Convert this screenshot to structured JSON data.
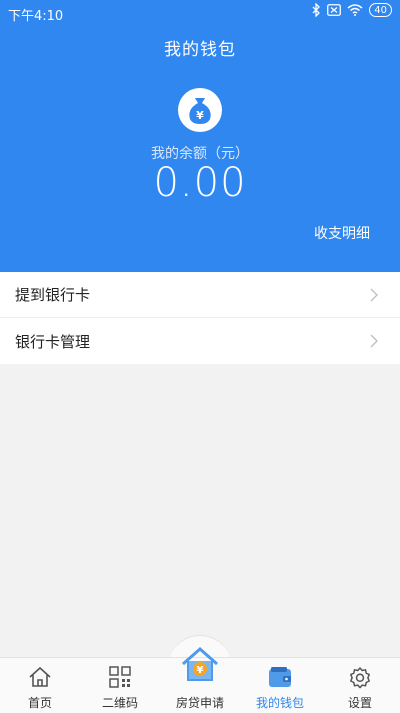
{
  "status_bar": {
    "time": "下午4:10",
    "battery": "40"
  },
  "header": {
    "title": "我的钱包",
    "balance_label": "我的余额（元）",
    "balance_value": "0.00",
    "details_link": "收支明细"
  },
  "menu": {
    "items": [
      {
        "label": "提到银行卡"
      },
      {
        "label": "银行卡管理"
      }
    ]
  },
  "tabbar": {
    "tabs": [
      {
        "label": "首页",
        "icon": "home-icon"
      },
      {
        "label": "二维码",
        "icon": "qrcode-icon"
      },
      {
        "label": "房贷申请",
        "icon": "house-loan-icon"
      },
      {
        "label": "我的钱包",
        "icon": "wallet-icon"
      },
      {
        "label": "设置",
        "icon": "settings-icon"
      }
    ],
    "active_index": 3
  },
  "colors": {
    "primary": "#2f87ef",
    "background": "#f2f2f2",
    "tab_active": "#2f87ef"
  }
}
